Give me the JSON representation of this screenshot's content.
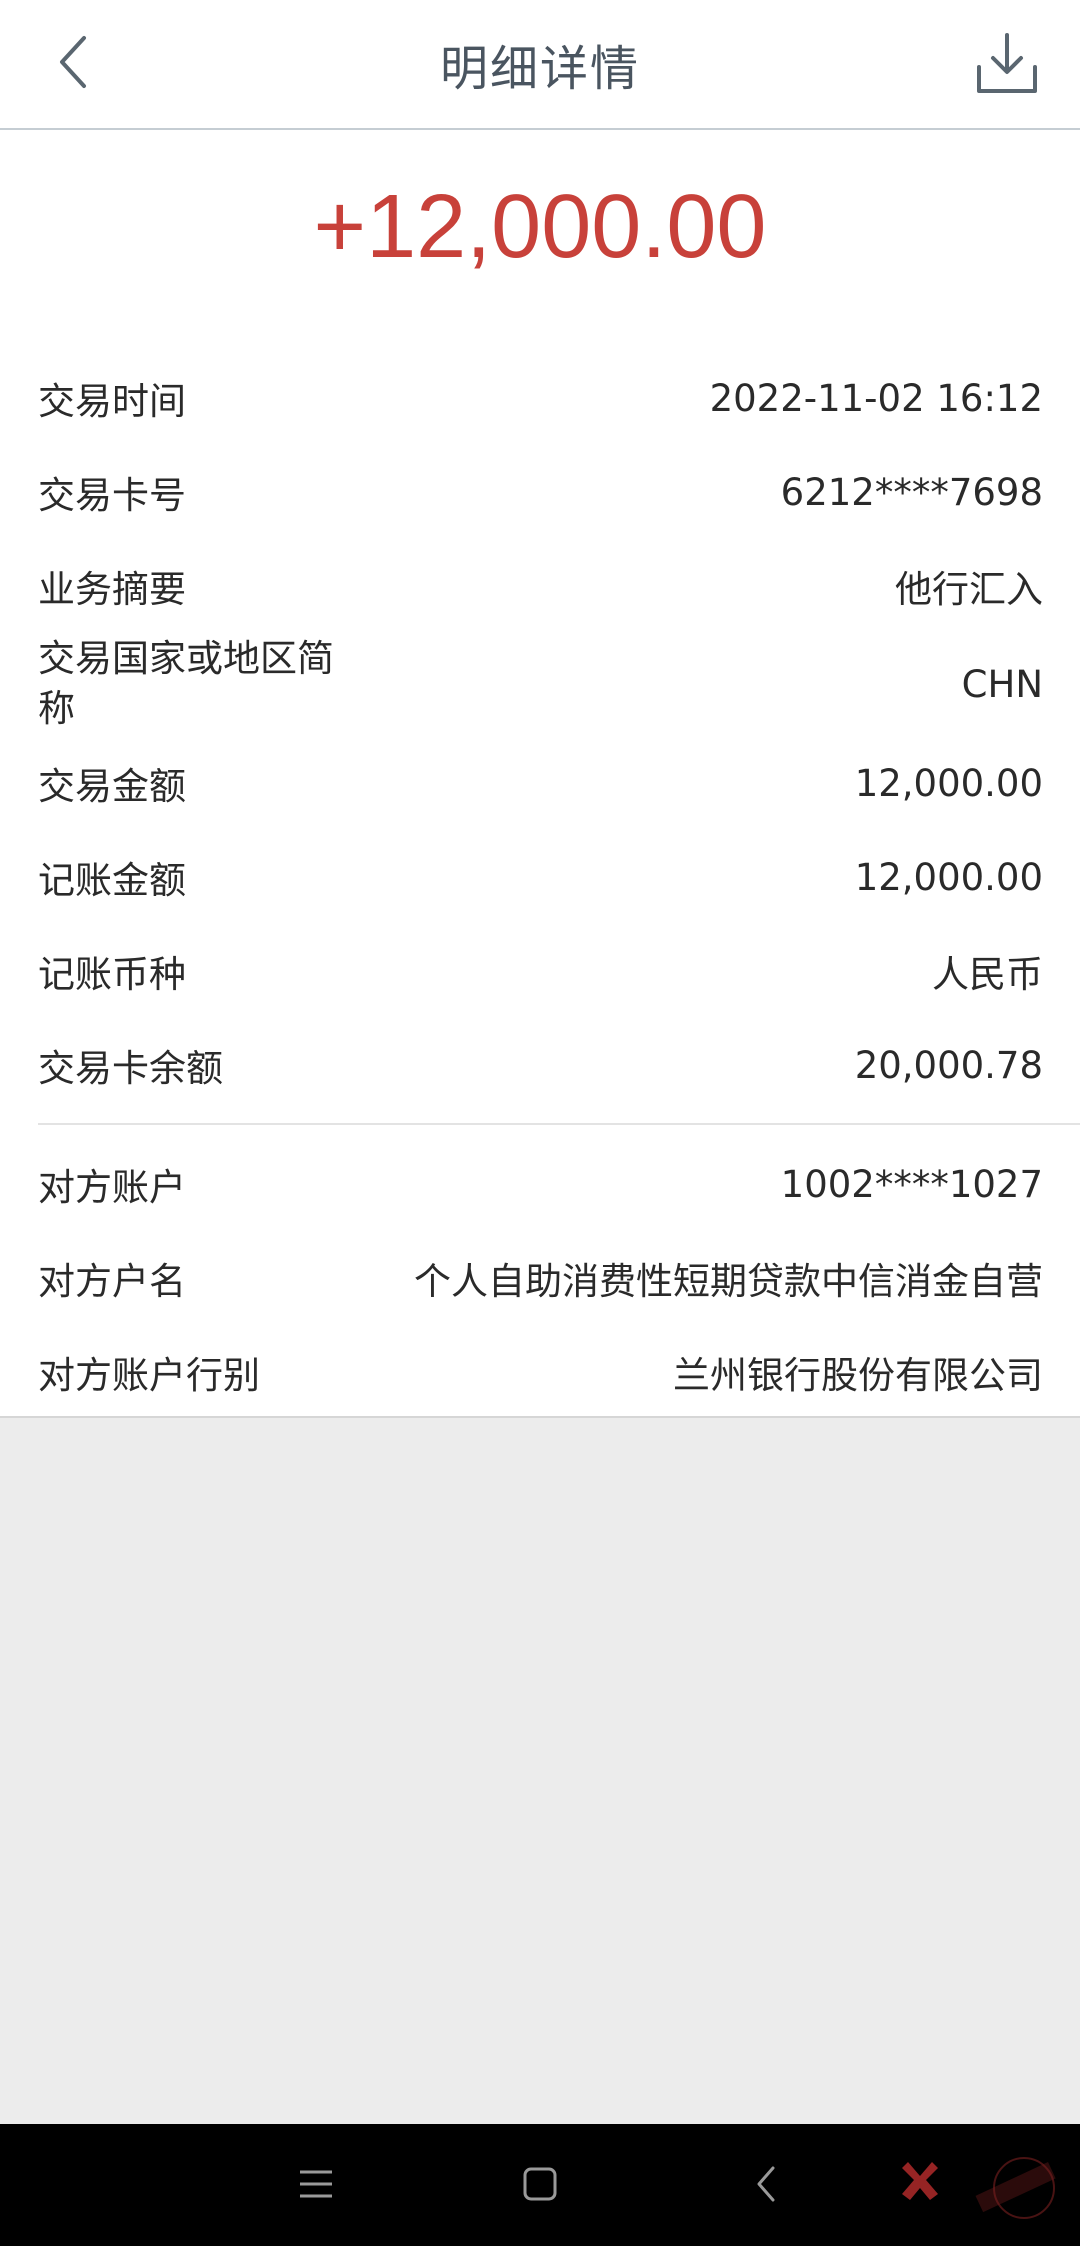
{
  "header": {
    "title": "明细详情",
    "back_icon": "chevron-left-icon",
    "download_icon": "download-icon"
  },
  "amount": "+12,000.00",
  "colors": {
    "amount": "#c8413a",
    "title": "#4a5560",
    "background": "#ececec"
  },
  "details": [
    {
      "label": "交易时间",
      "value": "2022-11-02 16:12"
    },
    {
      "label": "交易卡号",
      "value": "6212****7698"
    },
    {
      "label": "业务摘要",
      "value": "他行汇入"
    },
    {
      "label": "交易国家或地区简称",
      "value": "CHN"
    },
    {
      "label": "交易金额",
      "value": "12,000.00"
    },
    {
      "label": "记账金额",
      "value": "12,000.00"
    },
    {
      "label": "记账币种",
      "value": "人民币"
    },
    {
      "label": "交易卡余额",
      "value": "20,000.78"
    }
  ],
  "counterparty": [
    {
      "label": "对方账户",
      "value": "1002****1027"
    },
    {
      "label": "对方户名",
      "value": "个人自助消费性短期贷款中信消金自营"
    },
    {
      "label": "对方账户行别",
      "value": "兰州银行股份有限公司"
    }
  ],
  "navbar": {
    "icons": [
      "menu-icon",
      "home-icon",
      "back-icon"
    ]
  }
}
